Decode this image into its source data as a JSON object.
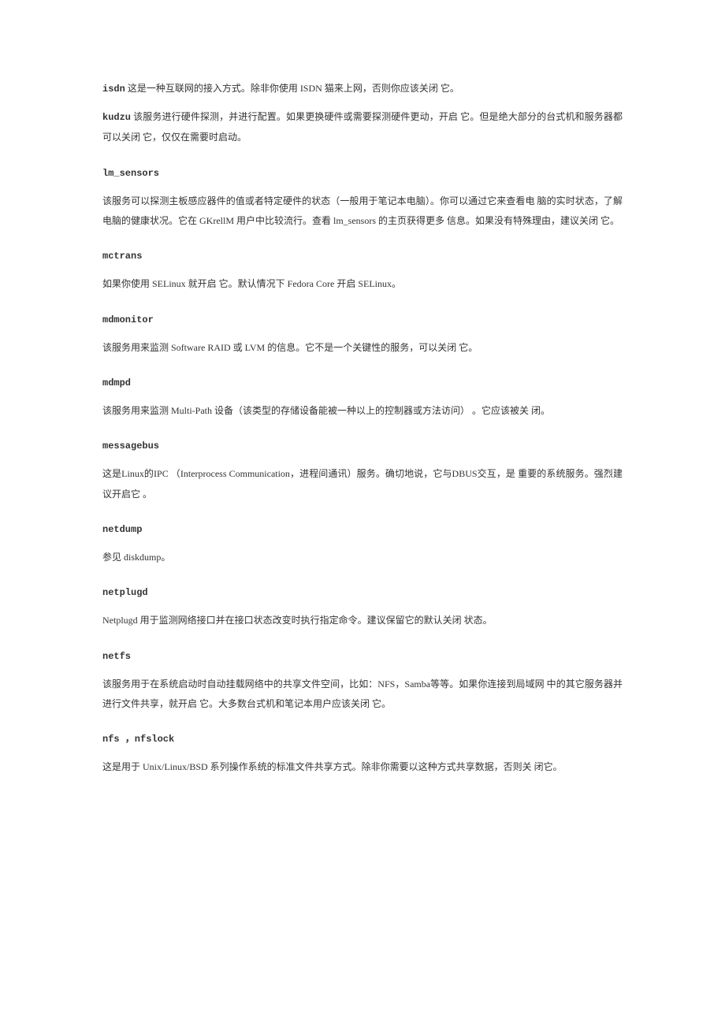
{
  "entries": [
    {
      "head": "isdn",
      "inline": true,
      "body": "这是一种互联网的接入方式。除非你使用 ISDN 猫来上网，否则你应该关闭 它。"
    },
    {
      "head": "kudzu",
      "inline": true,
      "body": "该服务进行硬件探测，并进行配置。如果更换硬件或需要探测硬件更动，开启 它。但是绝大部分的台式机和服务器都可以关闭 它，仅仅在需要时启动。"
    },
    {
      "head": "lm_sensors",
      "body": "该服务可以探测主板感应器件的值或者特定硬件的状态（一般用于笔记本电脑）。你可以通过它来查看电 脑的实时状态，了解电脑的健康状况。它在 GKrellM 用户中比较流行。查看 lm_sensors 的主页获得更多 信息。如果没有特殊理由，建议关闭 它。"
    },
    {
      "head": "mctrans",
      "body": "如果你使用 SELinux 就开启 它。默认情况下 Fedora Core 开启 SELinux。"
    },
    {
      "head": "mdmonitor",
      "body": "该服务用来监测 Software RAID 或 LVM 的信息。它不是一个关键性的服务，可以关闭 它。"
    },
    {
      "head": "mdmpd",
      "body": "该服务用来监测 Multi-Path 设备（该类型的存储设备能被一种以上的控制器或方法访问） 。它应该被关 闭。"
    },
    {
      "head": "messagebus",
      "body": "这是Linux的IPC （Interprocess Communication，进程间通讯）服务。确切地说，它与DBUS交互，是 重要的系统服务。强烈建议开启它 。"
    },
    {
      "head": "netdump",
      "body": "参见 diskdump。"
    },
    {
      "head": "netplugd",
      "body": "Netplugd 用于监测网络接口并在接口状态改变时执行指定命令。建议保留它的默认关闭 状态。"
    },
    {
      "head": "netfs",
      "body": "该服务用于在系统启动时自动挂载网络中的共享文件空间，比如：NFS，Samba等等。如果你连接到局域网 中的其它服务器并进行文件共享，就开启 它。大多数台式机和笔记本用户应该关闭 它。"
    },
    {
      "head": "nfs ，nfslock",
      "body": "这是用于 Unix/Linux/BSD 系列操作系统的标准文件共享方式。除非你需要以这种方式共享数据，否则关 闭它。"
    }
  ]
}
